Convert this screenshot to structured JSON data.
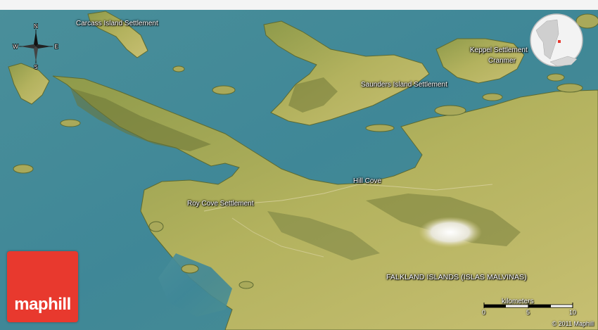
{
  "labels": {
    "carcass": "Carcass Island Settlement",
    "keppel": "Keppel Settlement",
    "cranmer": "Cranmer",
    "saunders": "Saunders Island Settlement",
    "hill_cove": "Hill Cove",
    "roy_cove": "Roy Cove Settlement",
    "country": "FALKLAND ISLANDS (ISLAS MALVINAS)"
  },
  "compass": {
    "n": "N",
    "s": "S",
    "e": "E",
    "w": "W"
  },
  "brand": {
    "logo_text": "maphill"
  },
  "scale": {
    "title": "kilometers",
    "ticks": [
      "0",
      "5",
      "10"
    ]
  },
  "copyright": "© 2011 Maphill",
  "colors": {
    "sea": "#3f8a9a",
    "land": "#b4b660",
    "land_dark": "#6e7a3c",
    "brand": "#e8392e"
  }
}
